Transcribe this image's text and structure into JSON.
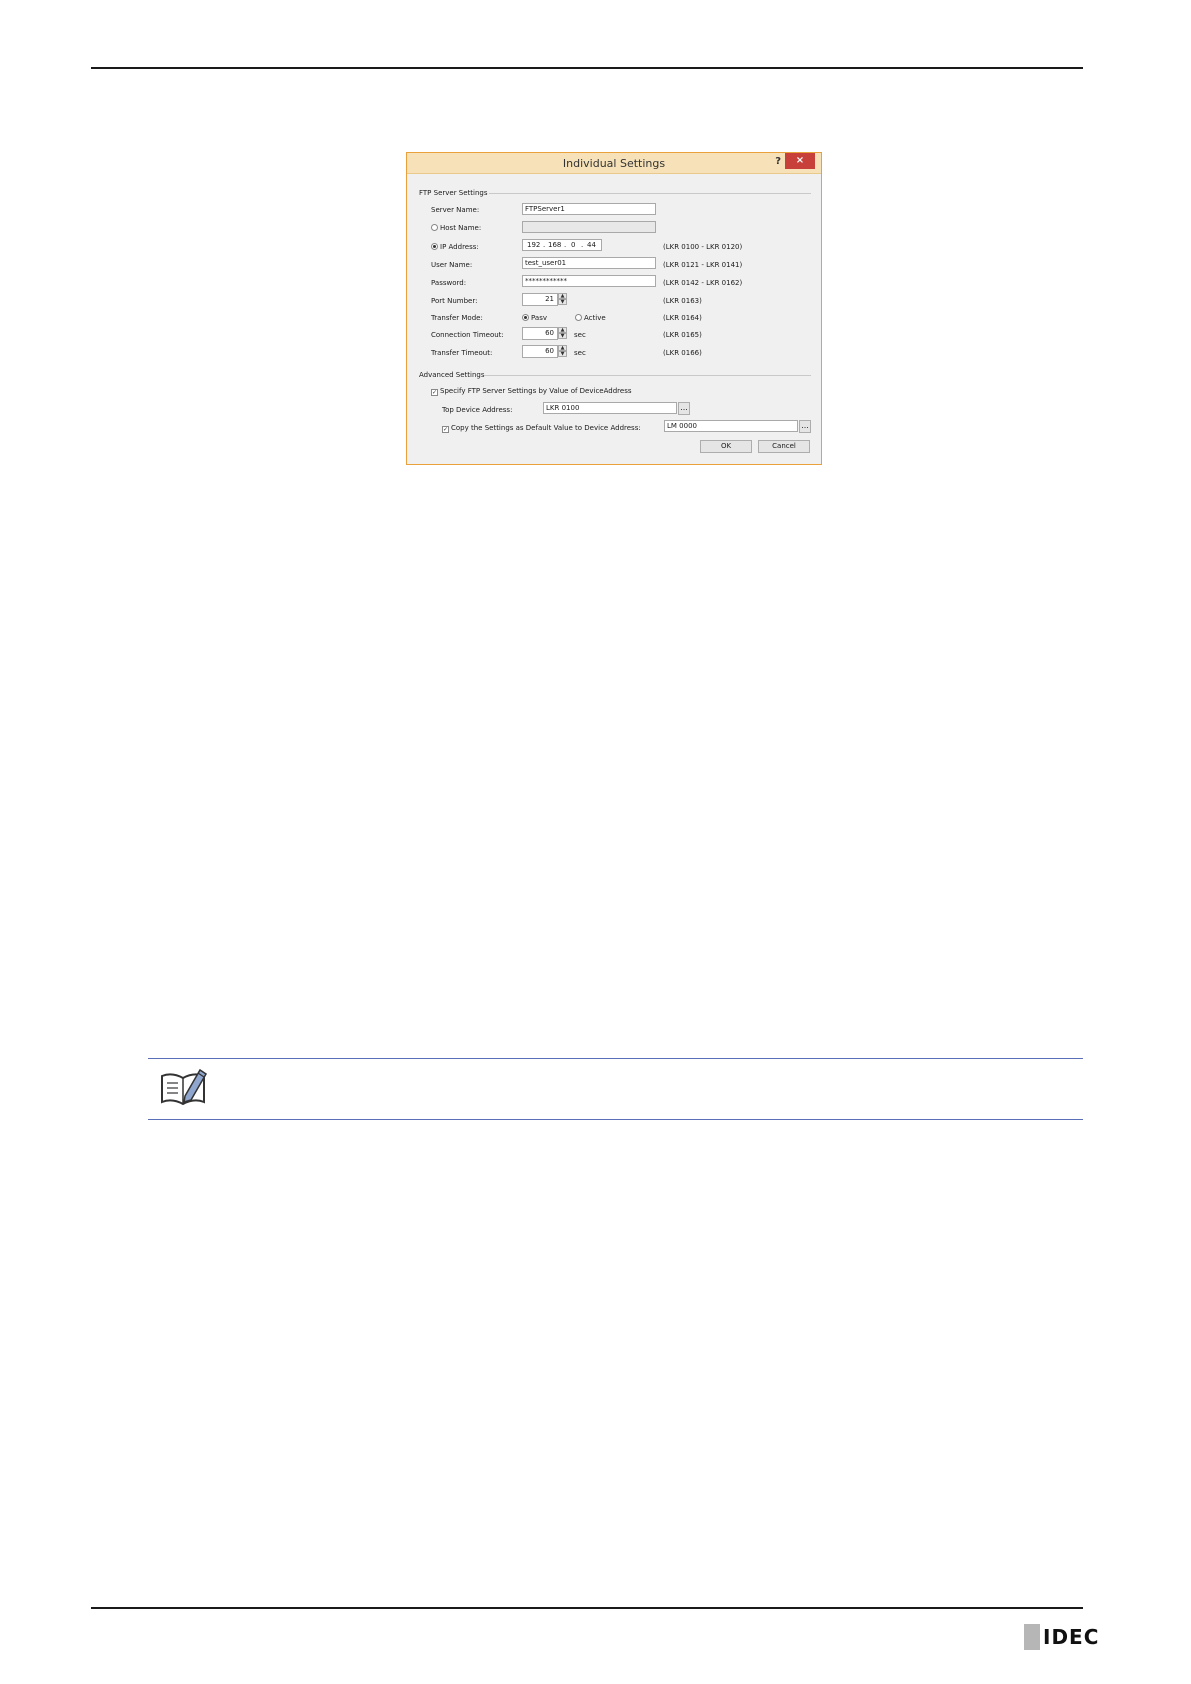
{
  "dialog": {
    "title": "Individual Settings",
    "help_label": "?",
    "close_label": "×",
    "ftp_group_label": "FTP Server Settings",
    "server_name": {
      "label": "Server Name:",
      "value": "FTPServer1"
    },
    "host_name": {
      "label": "Host Name:",
      "value": "",
      "selected": false
    },
    "ip_address": {
      "label": "IP Address:",
      "octets": [
        "192",
        "168",
        "0",
        "44"
      ],
      "range": "(LKR 0100 - LKR 0120)",
      "selected": true
    },
    "user_name": {
      "label": "User Name:",
      "value": "test_user01",
      "range": "(LKR 0121 - LKR 0141)"
    },
    "password": {
      "label": "Password:",
      "value": "************",
      "range": "(LKR 0142 - LKR 0162)"
    },
    "port_number": {
      "label": "Port Number:",
      "value": "21",
      "range": "(LKR 0163)"
    },
    "transfer_mode": {
      "label": "Transfer Mode:",
      "options": [
        "Pasv",
        "Active"
      ],
      "selected": "Pasv",
      "range": "(LKR 0164)"
    },
    "connection_timeout": {
      "label": "Connection Timeout:",
      "value": "60",
      "unit": "sec",
      "range": "(LKR 0165)"
    },
    "transfer_timeout": {
      "label": "Transfer Timeout:",
      "value": "60",
      "unit": "sec",
      "range": "(LKR 0166)"
    },
    "advanced_group_label": "Advanced Settings",
    "specify_checkbox": {
      "label": "Specify FTP Server Settings by Value of DeviceAddress",
      "checked": true
    },
    "top_device_address": {
      "label": "Top Device Address:",
      "value": "LKR 0100"
    },
    "copy_checkbox": {
      "label": "Copy the Settings as Default Value to Device Address:",
      "checked": true,
      "value": "LM 0000"
    },
    "browse_label": "...",
    "ok_label": "OK",
    "cancel_label": "Cancel"
  },
  "footer": {
    "logo_text": "IDEC"
  },
  "colors": {
    "title_bar": "#f6e1b8",
    "close_button": "#c7413a",
    "note_rule": "#5a6fb8"
  },
  "icons": {
    "note": "note-pencil-icon"
  }
}
